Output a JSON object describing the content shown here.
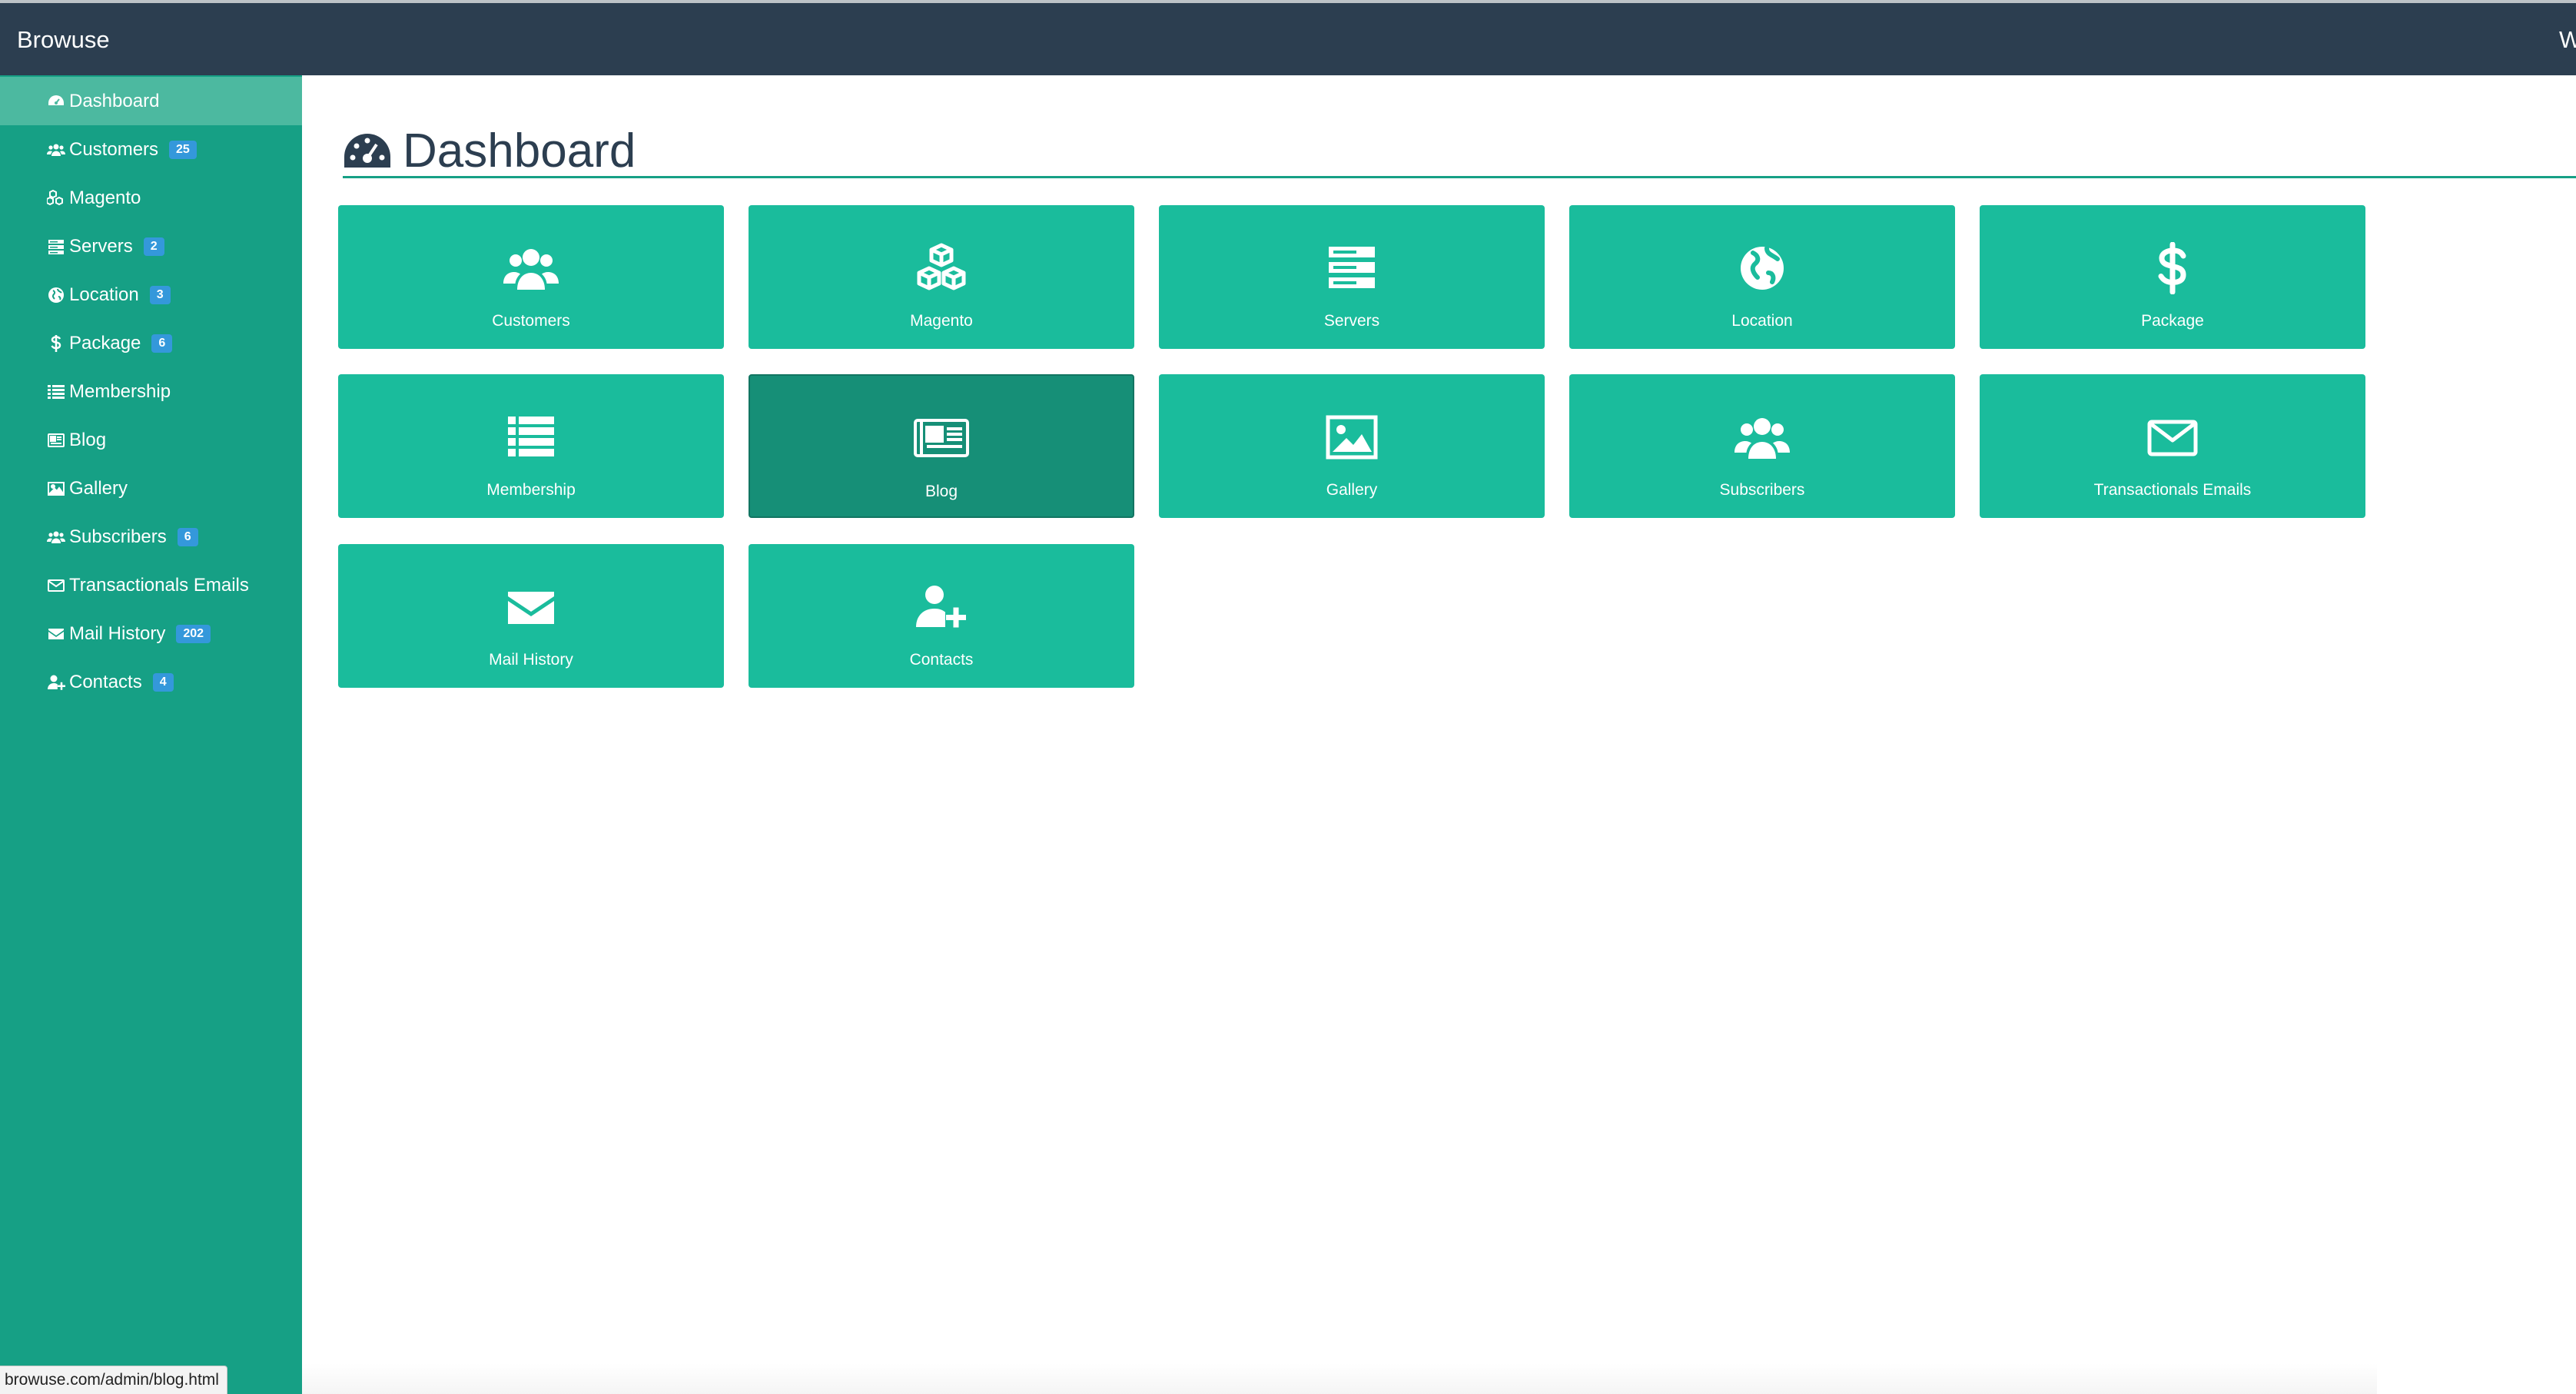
{
  "app": {
    "brand": "Browuse",
    "top_right_partial": "W"
  },
  "page": {
    "title": "Dashboard"
  },
  "sidebar": {
    "items": [
      {
        "label": "Dashboard",
        "icon": "dashboard-icon",
        "active": true
      },
      {
        "label": "Customers",
        "icon": "users-icon",
        "badge": "25"
      },
      {
        "label": "Magento",
        "icon": "cubes-icon"
      },
      {
        "label": "Servers",
        "icon": "server-icon",
        "badge": "2"
      },
      {
        "label": "Location",
        "icon": "globe-icon",
        "badge": "3"
      },
      {
        "label": "Package",
        "icon": "dollar-icon",
        "badge": "6"
      },
      {
        "label": "Membership",
        "icon": "list-icon"
      },
      {
        "label": "Blog",
        "icon": "newspaper-icon"
      },
      {
        "label": "Gallery",
        "icon": "image-icon"
      },
      {
        "label": "Subscribers",
        "icon": "users-icon",
        "badge": "6"
      },
      {
        "label": "Transactionals Emails",
        "icon": "envelope-outline-icon"
      },
      {
        "label": "Mail History",
        "icon": "envelope-icon",
        "badge": "202"
      },
      {
        "label": "Contacts",
        "icon": "user-plus-icon",
        "badge": "4"
      }
    ]
  },
  "tiles": [
    {
      "label": "Customers",
      "icon": "users-icon"
    },
    {
      "label": "Magento",
      "icon": "cubes-icon"
    },
    {
      "label": "Servers",
      "icon": "server-icon"
    },
    {
      "label": "Location",
      "icon": "globe-icon"
    },
    {
      "label": "Package",
      "icon": "dollar-icon"
    },
    {
      "label": "Membership",
      "icon": "list-icon"
    },
    {
      "label": "Blog",
      "icon": "newspaper-icon",
      "active": true
    },
    {
      "label": "Gallery",
      "icon": "image-icon"
    },
    {
      "label": "Subscribers",
      "icon": "users-icon"
    },
    {
      "label": "Transactionals Emails",
      "icon": "envelope-outline-icon"
    },
    {
      "label": "Mail History",
      "icon": "envelope-icon"
    },
    {
      "label": "Contacts",
      "icon": "user-plus-icon"
    }
  ],
  "status_bar": {
    "url": "browuse.com/admin/blog.html"
  },
  "colors": {
    "topbar": "#2c3e50",
    "sidebar": "#16a085",
    "tile": "#1abc9c",
    "tile_active": "#168f77",
    "badge": "#3498db"
  }
}
